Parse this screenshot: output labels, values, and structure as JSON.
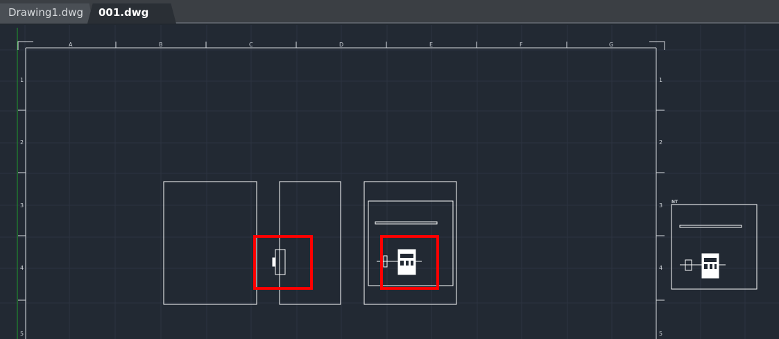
{
  "tabs": [
    {
      "label": "Drawing1.dwg",
      "active": false
    },
    {
      "label": "001.dwg",
      "active": true
    }
  ],
  "tab_close_glyph": "×",
  "column_labels": [
    "A",
    "B",
    "C",
    "D",
    "E",
    "F",
    "G"
  ],
  "row_labels_left": [
    "1",
    "2",
    "3",
    "4",
    "5"
  ],
  "row_labels_right": [
    "1",
    "2",
    "3",
    "4",
    "5"
  ],
  "detail_label": "NT",
  "colors": {
    "background": "#222933",
    "linework": "#ffffff",
    "highlight": "#ff0000",
    "grid": "#2c3440",
    "ucs_axis": "#1f9a2d"
  }
}
